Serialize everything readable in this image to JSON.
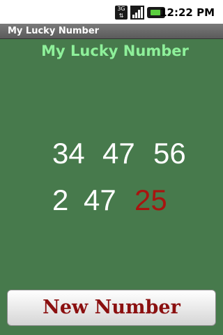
{
  "status_bar": {
    "network_label": "3G",
    "time": "12:22 PM",
    "icons": [
      "network-3g-icon",
      "signal-icon",
      "battery-icon"
    ]
  },
  "window": {
    "title": "My Lucky Number"
  },
  "main": {
    "heading": "My Lucky Number",
    "numbers": [
      [
        "34",
        "47",
        "56"
      ],
      [
        "2",
        "47",
        "25"
      ]
    ],
    "highlighted_number": "25",
    "colors": {
      "background": "#477a4c",
      "heading": "#8ef09a",
      "number": "#ffffff",
      "highlight": "#a8140f"
    }
  },
  "button": {
    "label": "New Number"
  }
}
